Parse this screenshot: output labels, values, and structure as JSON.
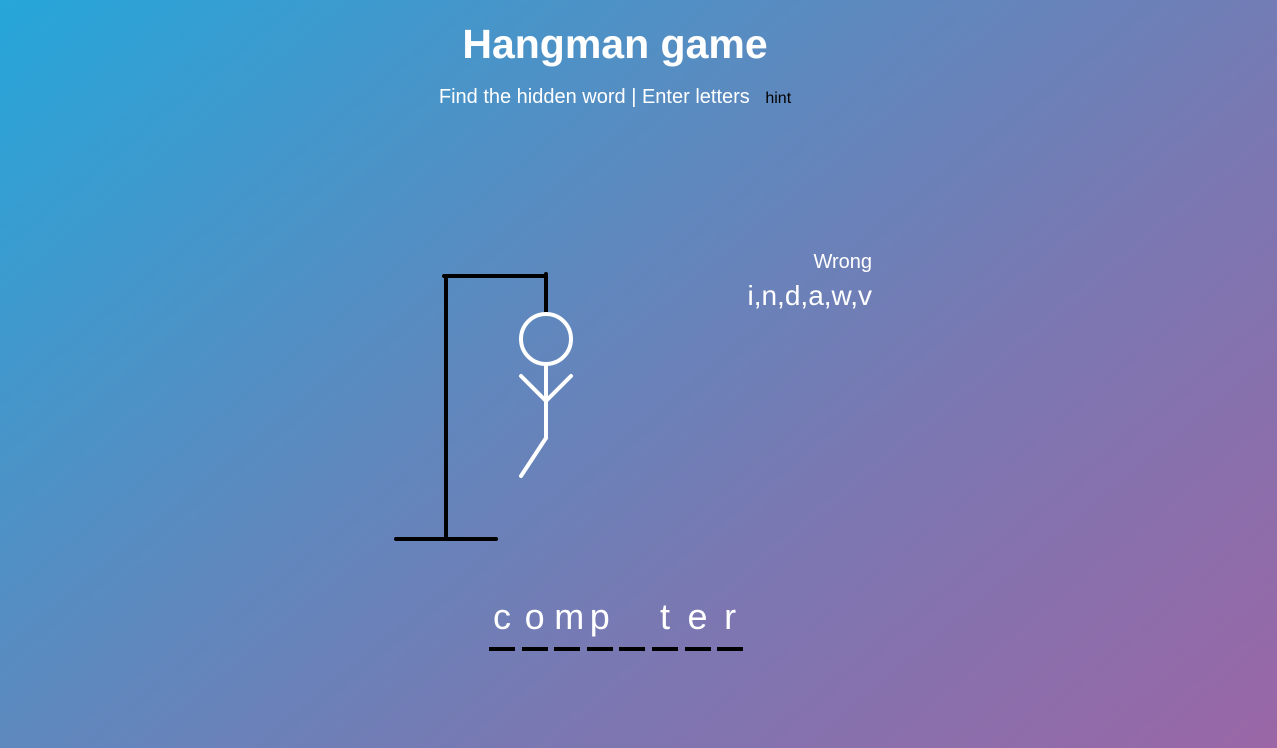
{
  "header": {
    "title": "Hangman game",
    "subtitle": "Find the hidden word | Enter letters",
    "hint_label": "hint"
  },
  "wrong": {
    "label": "Wrong",
    "letters": "i,n,d,a,w,v"
  },
  "word": {
    "letters": [
      "c",
      "o",
      "m",
      "p",
      "",
      "t",
      "e",
      "r"
    ]
  },
  "figure": {
    "parts_shown": [
      "head",
      "body",
      "left-arm",
      "right-arm",
      "left-leg"
    ]
  },
  "colors": {
    "gallows": "#000000",
    "figure": "#ffffff",
    "gradient_start": "#26a6d9",
    "gradient_end": "#9a66a6"
  }
}
